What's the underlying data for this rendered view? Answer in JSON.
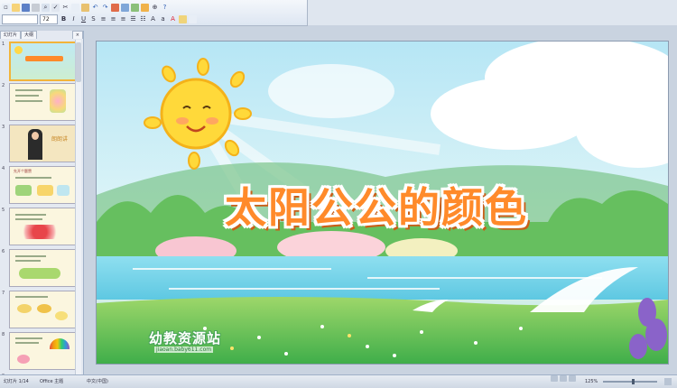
{
  "toolbar": {
    "font_name": "",
    "font_size": "72"
  },
  "panel": {
    "tab_slides": "幻灯片",
    "tab_outline": "大纲",
    "close": "×",
    "thumbnails": [
      {
        "number": "1"
      },
      {
        "number": "2"
      },
      {
        "number": "3",
        "caption": "朗朗讲"
      },
      {
        "number": "4",
        "caption": "先开个题赞"
      },
      {
        "number": "5"
      },
      {
        "number": "6"
      },
      {
        "number": "7"
      },
      {
        "number": "8"
      },
      {
        "number": "9"
      }
    ]
  },
  "slide": {
    "title": "太阳公公的颜色",
    "logo_text": "幼教资源站",
    "logo_url": "jiaoan.baby611.com"
  },
  "status": {
    "slide_count": "幻灯片 1/14",
    "theme": "Office 主题",
    "language": "中文(中国)",
    "zoom": "125%"
  },
  "colors": {
    "title_fill": "#ff8a2a",
    "title_shadow": "#c95f18",
    "selected_thumb": "#f2b43a"
  }
}
